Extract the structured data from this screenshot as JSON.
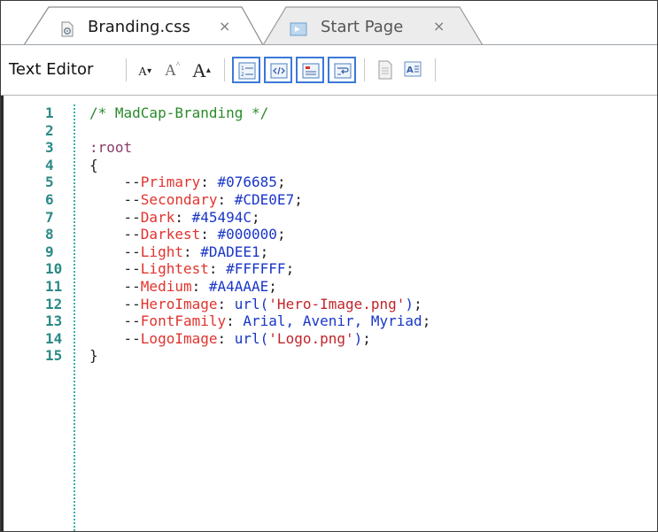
{
  "tabs": [
    {
      "label": "Branding.css",
      "close": "×",
      "active": true,
      "icon": "css-file-icon"
    },
    {
      "label": "Start Page",
      "close": "×",
      "active": false,
      "icon": "start-page-icon"
    }
  ],
  "toolbar": {
    "title": "Text Editor",
    "font_small": "A",
    "font_grow": "A",
    "font_large": "A"
  },
  "editor": {
    "lines": [
      {
        "num": "1",
        "indent": "",
        "parts": [
          {
            "cls": "cm",
            "text": "/* MadCap-Branding */"
          }
        ]
      },
      {
        "num": "2",
        "indent": "",
        "parts": []
      },
      {
        "num": "3",
        "indent": "",
        "parts": [
          {
            "cls": "sel",
            "text": ":root"
          }
        ]
      },
      {
        "num": "4",
        "indent": "",
        "parts": [
          {
            "cls": "pun",
            "text": "{"
          }
        ]
      },
      {
        "num": "5",
        "indent": "    ",
        "parts": [
          {
            "cls": "pun",
            "text": "--"
          },
          {
            "cls": "prop",
            "text": "Primary"
          },
          {
            "cls": "pun",
            "text": ": "
          },
          {
            "cls": "val",
            "text": "#076685"
          },
          {
            "cls": "pun",
            "text": ";"
          }
        ]
      },
      {
        "num": "6",
        "indent": "    ",
        "parts": [
          {
            "cls": "pun",
            "text": "--"
          },
          {
            "cls": "prop",
            "text": "Secondary"
          },
          {
            "cls": "pun",
            "text": ": "
          },
          {
            "cls": "val",
            "text": "#CDE0E7"
          },
          {
            "cls": "pun",
            "text": ";"
          }
        ]
      },
      {
        "num": "7",
        "indent": "    ",
        "parts": [
          {
            "cls": "pun",
            "text": "--"
          },
          {
            "cls": "prop",
            "text": "Dark"
          },
          {
            "cls": "pun",
            "text": ": "
          },
          {
            "cls": "val",
            "text": "#45494C"
          },
          {
            "cls": "pun",
            "text": ";"
          }
        ]
      },
      {
        "num": "8",
        "indent": "    ",
        "parts": [
          {
            "cls": "pun",
            "text": "--"
          },
          {
            "cls": "prop",
            "text": "Darkest"
          },
          {
            "cls": "pun",
            "text": ": "
          },
          {
            "cls": "val",
            "text": "#000000"
          },
          {
            "cls": "pun",
            "text": ";"
          }
        ]
      },
      {
        "num": "9",
        "indent": "    ",
        "parts": [
          {
            "cls": "pun",
            "text": "--"
          },
          {
            "cls": "prop",
            "text": "Light"
          },
          {
            "cls": "pun",
            "text": ": "
          },
          {
            "cls": "val",
            "text": "#DADEE1"
          },
          {
            "cls": "pun",
            "text": ";"
          }
        ]
      },
      {
        "num": "10",
        "indent": "    ",
        "parts": [
          {
            "cls": "pun",
            "text": "--"
          },
          {
            "cls": "prop",
            "text": "Lightest"
          },
          {
            "cls": "pun",
            "text": ": "
          },
          {
            "cls": "val",
            "text": "#FFFFFF"
          },
          {
            "cls": "pun",
            "text": ";"
          }
        ]
      },
      {
        "num": "11",
        "indent": "    ",
        "parts": [
          {
            "cls": "pun",
            "text": "--"
          },
          {
            "cls": "prop",
            "text": "Medium"
          },
          {
            "cls": "pun",
            "text": ": "
          },
          {
            "cls": "val",
            "text": "#A4AAAE"
          },
          {
            "cls": "pun",
            "text": ";"
          }
        ]
      },
      {
        "num": "12",
        "indent": "    ",
        "parts": [
          {
            "cls": "pun",
            "text": "--"
          },
          {
            "cls": "prop",
            "text": "HeroImage"
          },
          {
            "cls": "pun",
            "text": ": "
          },
          {
            "cls": "val",
            "text": "url("
          },
          {
            "cls": "str",
            "text": "'Hero-Image.png'"
          },
          {
            "cls": "val",
            "text": ")"
          },
          {
            "cls": "pun",
            "text": ";"
          }
        ]
      },
      {
        "num": "13",
        "indent": "    ",
        "parts": [
          {
            "cls": "pun",
            "text": "--"
          },
          {
            "cls": "prop",
            "text": "FontFamily"
          },
          {
            "cls": "pun",
            "text": ": "
          },
          {
            "cls": "val",
            "text": "Arial, Avenir, Myriad"
          },
          {
            "cls": "pun",
            "text": ";"
          }
        ]
      },
      {
        "num": "14",
        "indent": "    ",
        "parts": [
          {
            "cls": "pun",
            "text": "--"
          },
          {
            "cls": "prop",
            "text": "LogoImage"
          },
          {
            "cls": "pun",
            "text": ": "
          },
          {
            "cls": "val",
            "text": "url("
          },
          {
            "cls": "str",
            "text": "'Logo.png'"
          },
          {
            "cls": "val",
            "text": ")"
          },
          {
            "cls": "pun",
            "text": ";"
          }
        ]
      },
      {
        "num": "15",
        "indent": "",
        "parts": [
          {
            "cls": "pun",
            "text": "}"
          }
        ]
      }
    ]
  },
  "colors": {
    "comment": "#2a8a2a",
    "property": "#e0342f",
    "value": "#1a36c8",
    "line_number": "#2b8a86",
    "toolbar_active_border": "#3b78d8"
  }
}
